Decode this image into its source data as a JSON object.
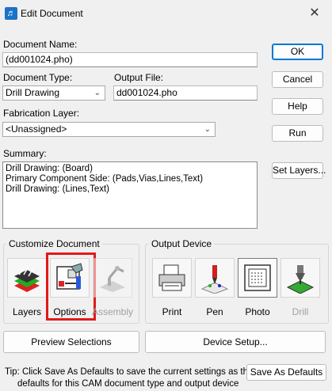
{
  "window": {
    "title": "Edit Document",
    "close_glyph": "✕",
    "app_icon_glyph": "♬"
  },
  "document_name": {
    "label": "Document Name:",
    "value": "(dd001024.pho)"
  },
  "document_type": {
    "label": "Document Type:",
    "value": "Drill Drawing"
  },
  "output_file": {
    "label": "Output File:",
    "value": "dd001024.pho"
  },
  "fabrication_layer": {
    "label": "Fabrication Layer:",
    "value": "<Unassigned>"
  },
  "summary": {
    "label": "Summary:",
    "lines": [
      "Drill Drawing: (Board)",
      "Primary Component Side: (Pads,Vias,Lines,Text)",
      "Drill Drawing: (Lines,Text)"
    ]
  },
  "buttons": {
    "ok": "OK",
    "cancel": "Cancel",
    "help": "Help",
    "run": "Run",
    "set_layers": "Set Layers...",
    "preview_selections": "Preview Selections",
    "device_setup": "Device Setup...",
    "save_as_defaults": "Save As Defaults"
  },
  "customize_document": {
    "title": "Customize Document",
    "items": [
      {
        "label": "Layers",
        "icon": "layers-icon",
        "enabled": true
      },
      {
        "label": "Options",
        "icon": "options-icon",
        "enabled": true,
        "highlighted": true
      },
      {
        "label": "Assembly",
        "icon": "assembly-icon",
        "enabled": false
      }
    ]
  },
  "output_device": {
    "title": "Output Device",
    "items": [
      {
        "label": "Print",
        "icon": "printer-icon",
        "enabled": true
      },
      {
        "label": "Pen",
        "icon": "pen-plotter-icon",
        "enabled": true
      },
      {
        "label": "Photo",
        "icon": "photo-plotter-icon",
        "enabled": true,
        "selected": true
      },
      {
        "label": "Drill",
        "icon": "drill-icon",
        "enabled": false
      }
    ]
  },
  "tip": {
    "line1": "Tip: Click Save As Defaults to save the current settings as the",
    "line2": "defaults for this CAM document type and output device"
  },
  "colors": {
    "highlight": "#e01a1a",
    "accent": "#0078d4"
  }
}
